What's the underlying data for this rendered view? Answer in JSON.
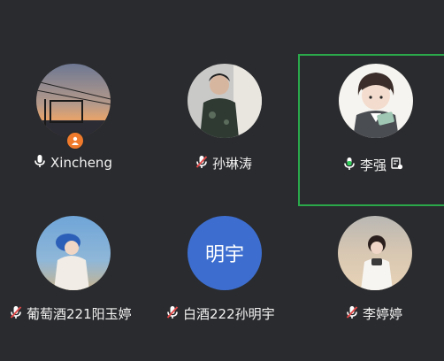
{
  "participants": [
    {
      "name": "Xincheng",
      "mic": "on",
      "host": true,
      "active": false
    },
    {
      "name": "孙琳涛",
      "mic": "muted",
      "host": false,
      "active": false
    },
    {
      "name": "李强",
      "mic": "speaking",
      "host": false,
      "active": true,
      "screen_share": true
    },
    {
      "name": "葡萄酒221阳玉婷",
      "mic": "muted",
      "host": false,
      "active": false
    },
    {
      "name": "白酒222孙明宇",
      "mic": "muted",
      "host": false,
      "active": false,
      "avatar_text": "明宇"
    },
    {
      "name": "李婷婷",
      "mic": "muted",
      "host": false,
      "active": false
    }
  ],
  "colors": {
    "background": "#2a2b2e",
    "active_border": "#2aa84a",
    "muted_red": "#e04848",
    "speaking_green": "#2fcf5a",
    "avatar_blue": "#3d6ecf",
    "host_badge": "#f07a2c"
  }
}
